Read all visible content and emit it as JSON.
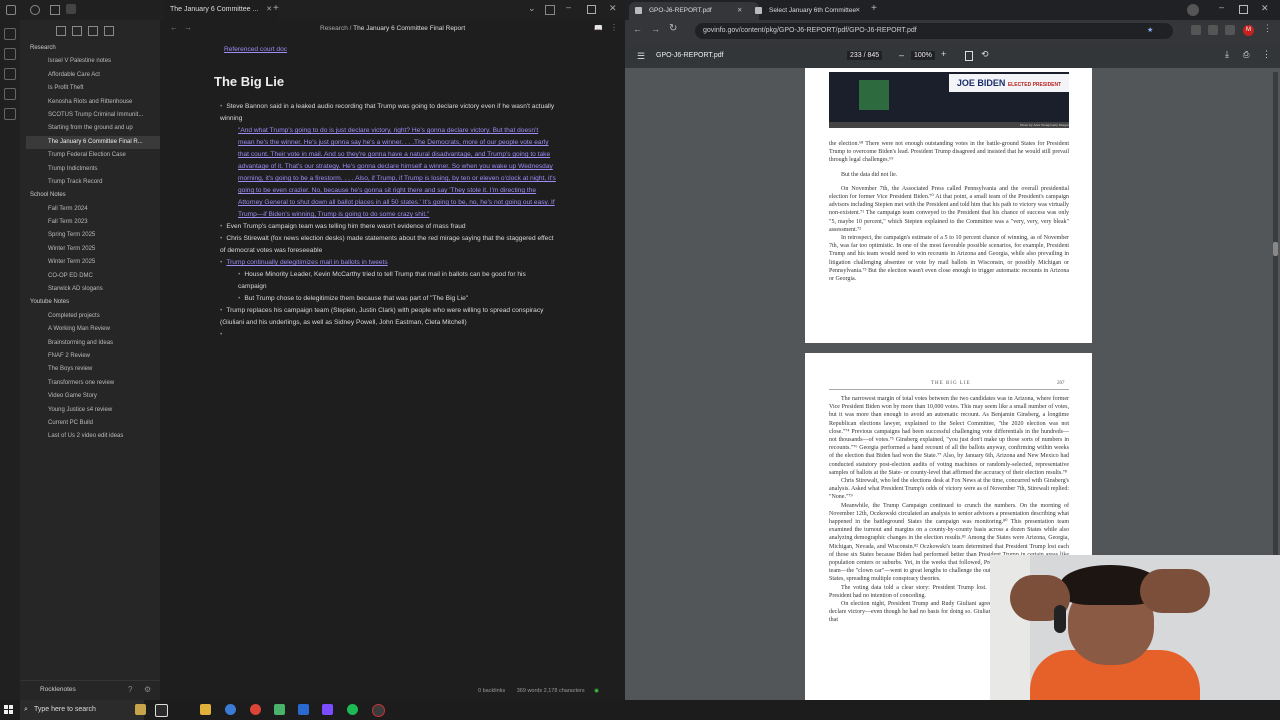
{
  "obsidian": {
    "tab_title": "The January 6 Committee ...",
    "breadcrumb_parent": "Research",
    "breadcrumb_sep": " / ",
    "breadcrumb_current": "The January 6 Committee Final Report",
    "sidebar": {
      "items": [
        {
          "label": "Research",
          "type": "folder"
        },
        {
          "label": "Israel V Palestine notes",
          "type": "file"
        },
        {
          "label": "Affordable Care Act",
          "type": "file"
        },
        {
          "label": "Is Profit Theft",
          "type": "file"
        },
        {
          "label": "Kenosha Riots and Rittenhouse",
          "type": "file"
        },
        {
          "label": "SCOTUS Trump Criminal Immunit...",
          "type": "file"
        },
        {
          "label": "Starting from the ground and up",
          "type": "file"
        },
        {
          "label": "The January 6 Committee Final R...",
          "type": "active"
        },
        {
          "label": "Trump Federal Election Case",
          "type": "file"
        },
        {
          "label": "Trump Indictments",
          "type": "file"
        },
        {
          "label": "Trump Track Record",
          "type": "file"
        },
        {
          "label": "School Notes",
          "type": "folder"
        },
        {
          "label": "Fall Term 2024",
          "type": "file"
        },
        {
          "label": "Fall Term 2023",
          "type": "file"
        },
        {
          "label": "Spring Term 2025",
          "type": "file"
        },
        {
          "label": "Winter Term 2025",
          "type": "file"
        },
        {
          "label": "Winter Term 2025",
          "type": "file"
        },
        {
          "label": "CO-OP ED DMC",
          "type": "file"
        },
        {
          "label": "Starwick AD slogans",
          "type": "file"
        },
        {
          "label": "Youtube Notes",
          "type": "folder"
        },
        {
          "label": "Completed projects",
          "type": "file"
        },
        {
          "label": "A Working Man Review",
          "type": "file"
        },
        {
          "label": "Brainstorming and Ideas",
          "type": "file"
        },
        {
          "label": "FNAF 2 Review",
          "type": "file"
        },
        {
          "label": "The Boys review",
          "type": "file"
        },
        {
          "label": "Transformers one review",
          "type": "file"
        },
        {
          "label": "Video Game Story",
          "type": "file"
        },
        {
          "label": "Young Justice s4 review",
          "type": "file"
        },
        {
          "label": "Current PC Build",
          "type": "file"
        },
        {
          "label": "Last of Us 2 video edit ideas",
          "type": "file"
        }
      ],
      "vault_name": "Rocklenotes"
    },
    "editor": {
      "top_link": "Referenced court doc",
      "heading": "The Big Lie",
      "b1": "Steve Bannon said in a leaked audio recording that Trump was going to declare victory even if he wasn't actually winning",
      "quote": "\"And what Trump's going to do is just declare victory, right? He's gonna declare victory. But that doesn't mean he's the winner. He's just gonna say he's a winner. . . .The Democrats, more of our people vote early that count. Their vote in mail. And so they're gonna have a natural disadvantage, and Trump's going to take advantage of it. That's our strategy. He's gonna declare himself a winner. So when you wake up Wednesday morning, it's going to be a firestorm. . . . Also, if Trump, if Trump is losing, by ten or eleven o'clock at night, it's going to be even crazier. No, because he's gonna sit right there and say 'They stole it. I'm directing the Attorney General to shut down all ballot places in all 50 states.' It's going to be, no, he's not going out easy. If Trump—if Biden's winning, Trump is going to do some crazy shit.\"",
      "b2": "Even Trump's campaign team was telling him there wasn't evidence of mass fraud",
      "b3": "Chris Stirewalt (fox news election desks) made statements about the red mirage saying that the staggered effect of democrat votes was foreseeable",
      "b4": "Trump continually delegitimizes mail in ballots in tweets",
      "b4a": "House Minority Leader, Kevin McCarthy tried to tell Trump that mail in ballots can be good for his campaign",
      "b4b": "But Trump chose to delegitimize them because that was part of \"The Big Lie\"",
      "b5": "Trump replaces his campaign team (Stepien, Justin Clark) with people who were willing to spread conspiracy (Giuliani and his underlings, as well as Sidney Powell, John Eastman, Cleta Mitchell)",
      "status_backlinks": "0 backlinks",
      "status_counts": "369 words 2,178 characters"
    }
  },
  "chrome": {
    "tab1": "GPO-J6-REPORT.pdf",
    "tab2": "Select January 6th Committee",
    "url": "govinfo.gov/content/pkg/GPO-J6-REPORT/pdf/GPO-J6-REPORT.pdf",
    "pdf_title": "GPO-J6-REPORT.pdf",
    "page_indicator": "233 / 845",
    "zoom": "100%",
    "page1": {
      "photo_caption": "Photo by Alex Wong/Getty Images",
      "banner": "JOE BIDEN",
      "banner2": "ELECTED PRESIDENT",
      "p1": "the election.⁶⁸ There were not enough outstanding votes in the battle-ground States for President Trump to overcome Biden's lead. President Trump disagreed and insisted that he would still prevail through legal challenges.⁶⁹",
      "p2": "But the data did not lie.",
      "p3": "On November 7th, the Associated Press called Pennsylvania and the overall presidential election for former Vice President Biden.⁷⁰ At that point, a small team of the President's campaign advisors including Stepien met with the President and told him that his path to victory was virtually non-existent.⁷¹ The campaign team conveyed to the President that his chance of success was only \"5, maybe 10 percent,\" which Stepien explained to the Committee was a \"very, very, very bleak\" assessment.⁷²",
      "p4": "In retrospect, the campaign's estimate of a 5 to 10 percent chance of winning, as of November 7th, was far too optimistic. In one of the most favorable possible scenarios, for example, President Trump and his team would need to win recounts in Arizona and Georgia, while also prevailing in litigation challenging absentee or vote by mail ballots in Wisconsin, or possibly Michigan or Pennsylvania.⁷³ But the election wasn't even close enough to trigger automatic recounts in Arizona or Georgia."
    },
    "page2": {
      "header": "THE BIG LIE",
      "page_no": "207",
      "p1": "The narrowest margin of total votes between the two candidates was in Arizona, where former Vice President Biden won by more than 10,000 votes. This may seem like a small number of votes, but it was more than enough to avoid an automatic recount. As Benjamin Ginsberg, a longtime Republican elections lawyer, explained to the Select Committee, \"the 2020 election was not close.\"⁷⁴ Previous campaigns had been successful challenging vote differentials in the hundreds—not thousands—of votes.⁷⁵ Ginsberg explained, \"you just don't make up those sorts of numbers in recounts.\"⁷⁶ Georgia performed a hand recount of all the ballots anyway, confirming within weeks of the election that Biden had won the State.⁷⁷ Also, by January 6th, Arizona and New Mexico had conducted statutory post-election audits of voting machines or randomly-selected, representative samples of ballots at the State- or county-level that affirmed the accuracy of their election results.⁷⁸",
      "p2": "Chris Stirewalt, who led the elections desk at Fox News at the time, concurred with Ginsberg's analysis. Asked what President Trump's odds of victory were as of November 7th, Stirewalt replied: \"None.\"⁷⁹",
      "p3": "Meanwhile, the Trump Campaign continued to crunch the numbers. On the morning of November 12th, Oczkowski circulated an analysis to senior advisors a presentation describing what happened in the battleground States the campaign was monitoring.⁸⁰ This presentation team examined the turnout and margins on a county-by-county basis across a dozen States while also analyzing demographic changes in the election results.⁸¹ Among the States were Arizona, Georgia, Michigan, Nevada, and Wisconsin.⁸² Oczkowski's team determined that President Trump lost each of those six States because Biden had performed better than President Trump in certain areas like population centers or suburbs. Yet, in the weeks that followed, President Trump and his new legal team—the \"clown car\"—went to great lengths to challenge the outcome of the election in these six States, spreading multiple conspiracy theories.",
      "p4": "The voting data told a clear story: President Trump lost. But regardless of the facts, the President had no intention of conceding.",
      "p5": "On election night, President Trump and Rudy Giuliani agreed that the President should just declare victory—even though he had no basis for doing so. Giuliani also told the Select Committee that"
    }
  },
  "taskbar": {
    "search_placeholder": "Type here to search"
  }
}
